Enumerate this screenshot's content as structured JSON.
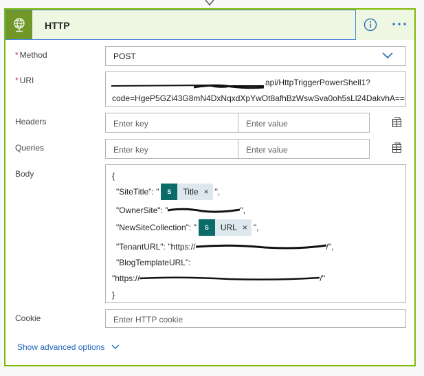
{
  "header": {
    "title": "HTTP",
    "icon": "globe-icon",
    "accent_color": "#709727",
    "info_icon": "info-icon",
    "more_icon": "more-horizontal-icon"
  },
  "method": {
    "label": "Method",
    "required_marker": "*",
    "value": "POST"
  },
  "uri": {
    "label": "URI",
    "required_marker": "*",
    "line1_visible": "api/HttpTriggerPowerShell1?",
    "line2": "code=HgeP5GZi43G8mN4DxNqxdXpYwOt8afhBzWswSva0oh5sLl24DakvhA=="
  },
  "headers": {
    "label": "Headers",
    "key_placeholder": "Enter key",
    "value_placeholder": "Enter value"
  },
  "queries": {
    "label": "Queries",
    "key_placeholder": "Enter key",
    "value_placeholder": "Enter value"
  },
  "body": {
    "label": "Body",
    "open_brace": "{",
    "site_title_prefix": "\"SiteTitle\": \"",
    "site_title_token": "Title",
    "site_title_suffix": "\",",
    "owner_site": "\"OwnerSite\": \"",
    "owner_site_tail": "\",",
    "new_site_prefix": "\"NewSiteCollection\": \"",
    "new_site_token": "URL",
    "new_site_suffix": "\",",
    "tenant_url_prefix": "\"TenantURL\": \"https://",
    "tenant_url_suffix": "/\",",
    "blog_template_key": "\"BlogTemplateURL\":",
    "blog_template_prefix": "\"https://",
    "blog_template_suffix": "/\"",
    "close_brace": "}",
    "token_remove": "×",
    "token_icon_text": "S"
  },
  "cookie": {
    "label": "Cookie",
    "placeholder": "Enter HTTP cookie"
  },
  "advanced": {
    "label": "Show advanced options"
  }
}
